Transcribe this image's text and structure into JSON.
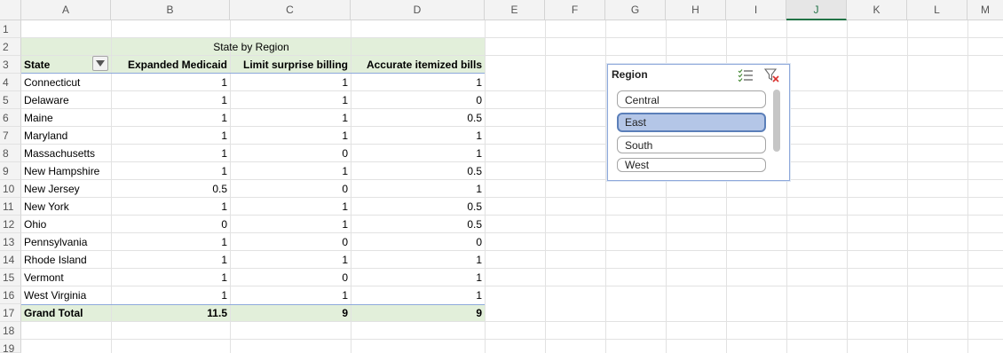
{
  "columns": [
    "A",
    "B",
    "C",
    "D",
    "E",
    "F",
    "G",
    "H",
    "I",
    "J",
    "K",
    "L",
    "M"
  ],
  "selected_column": "J",
  "rows": [
    "1",
    "2",
    "3",
    "4",
    "5",
    "6",
    "7",
    "8",
    "9",
    "10",
    "11",
    "12",
    "13",
    "14",
    "15",
    "16",
    "17",
    "18",
    "19"
  ],
  "pivot": {
    "title": "State by Region",
    "headers": {
      "state": "State",
      "col_b": "Expanded Medicaid",
      "col_c": "Limit surprise billing",
      "col_d": "Accurate itemized bills"
    },
    "data_rows": [
      {
        "state": "Connecticut",
        "b": "1",
        "c": "1",
        "d": "1"
      },
      {
        "state": "Delaware",
        "b": "1",
        "c": "1",
        "d": "0"
      },
      {
        "state": "Maine",
        "b": "1",
        "c": "1",
        "d": "0.5"
      },
      {
        "state": "Maryland",
        "b": "1",
        "c": "1",
        "d": "1"
      },
      {
        "state": "Massachusetts",
        "b": "1",
        "c": "0",
        "d": "1"
      },
      {
        "state": "New Hampshire",
        "b": "1",
        "c": "1",
        "d": "0.5"
      },
      {
        "state": "New Jersey",
        "b": "0.5",
        "c": "0",
        "d": "1"
      },
      {
        "state": "New York",
        "b": "1",
        "c": "1",
        "d": "0.5"
      },
      {
        "state": "Ohio",
        "b": "0",
        "c": "1",
        "d": "0.5"
      },
      {
        "state": "Pennsylvania",
        "b": "1",
        "c": "0",
        "d": "0"
      },
      {
        "state": "Rhode Island",
        "b": "1",
        "c": "1",
        "d": "1"
      },
      {
        "state": "Vermont",
        "b": "1",
        "c": "0",
        "d": "1"
      },
      {
        "state": "West Virginia",
        "b": "1",
        "c": "1",
        "d": "1"
      }
    ],
    "total": {
      "label": "Grand Total",
      "b": "11.5",
      "c": "9",
      "d": "9"
    }
  },
  "slicer": {
    "title": "Region",
    "items": [
      {
        "label": "Central",
        "selected": false
      },
      {
        "label": "East",
        "selected": true
      },
      {
        "label": "South",
        "selected": false
      },
      {
        "label": "West",
        "selected": false
      }
    ],
    "icons": [
      "multi-select-icon",
      "clear-filter-icon"
    ]
  },
  "colors": {
    "pivot_fill": "#e2efda",
    "slicer_selected": "#b4c6e7",
    "header_accent": "#217346"
  }
}
